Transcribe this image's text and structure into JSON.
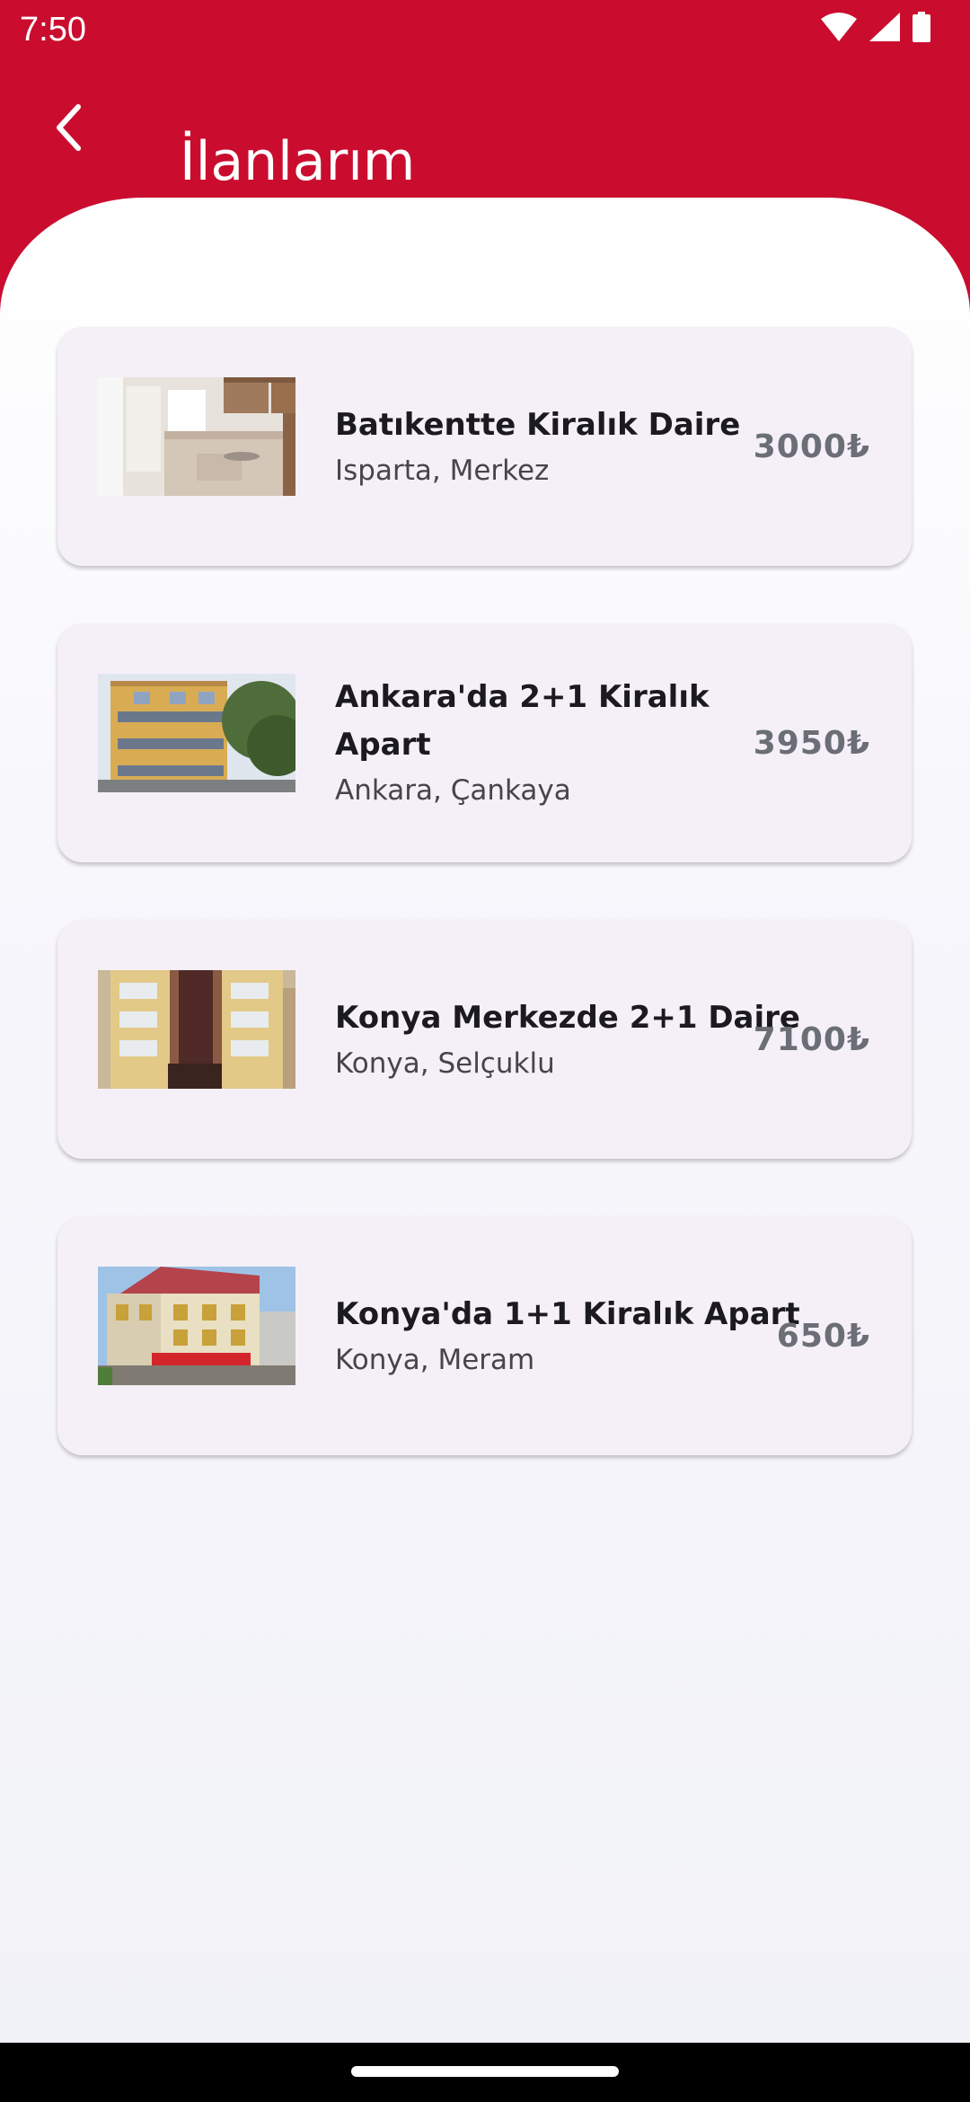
{
  "status_bar": {
    "time": "7:50",
    "icons": [
      "wifi-icon",
      "signal-icon",
      "battery-icon"
    ]
  },
  "app_bar": {
    "title": "İlanlarım",
    "back_icon": "back-arrow-icon"
  },
  "colors": {
    "brand_red": "#ca0d2f",
    "card_background": "#f5f0f7",
    "price_text": "#6b6e76"
  },
  "listings": [
    {
      "title": "Batıkentte Kiralık Daire",
      "location": "Isparta, Merkez",
      "price": "3000₺",
      "image": "apartment-interior-photo"
    },
    {
      "title": "Ankara'da 2+1 Kiralık Apart",
      "location": "Ankara, Çankaya",
      "price": "3950₺",
      "image": "apartment-building-photo"
    },
    {
      "title": "Konya Merkezde 2+1 Daire",
      "location": "Konya, Selçuklu",
      "price": "7100₺",
      "image": "apartment-building-photo"
    },
    {
      "title": "Konya'da 1+1 Kiralık Apart",
      "location": "Konya, Meram",
      "price": "650₺",
      "image": "apartment-building-photo"
    }
  ]
}
